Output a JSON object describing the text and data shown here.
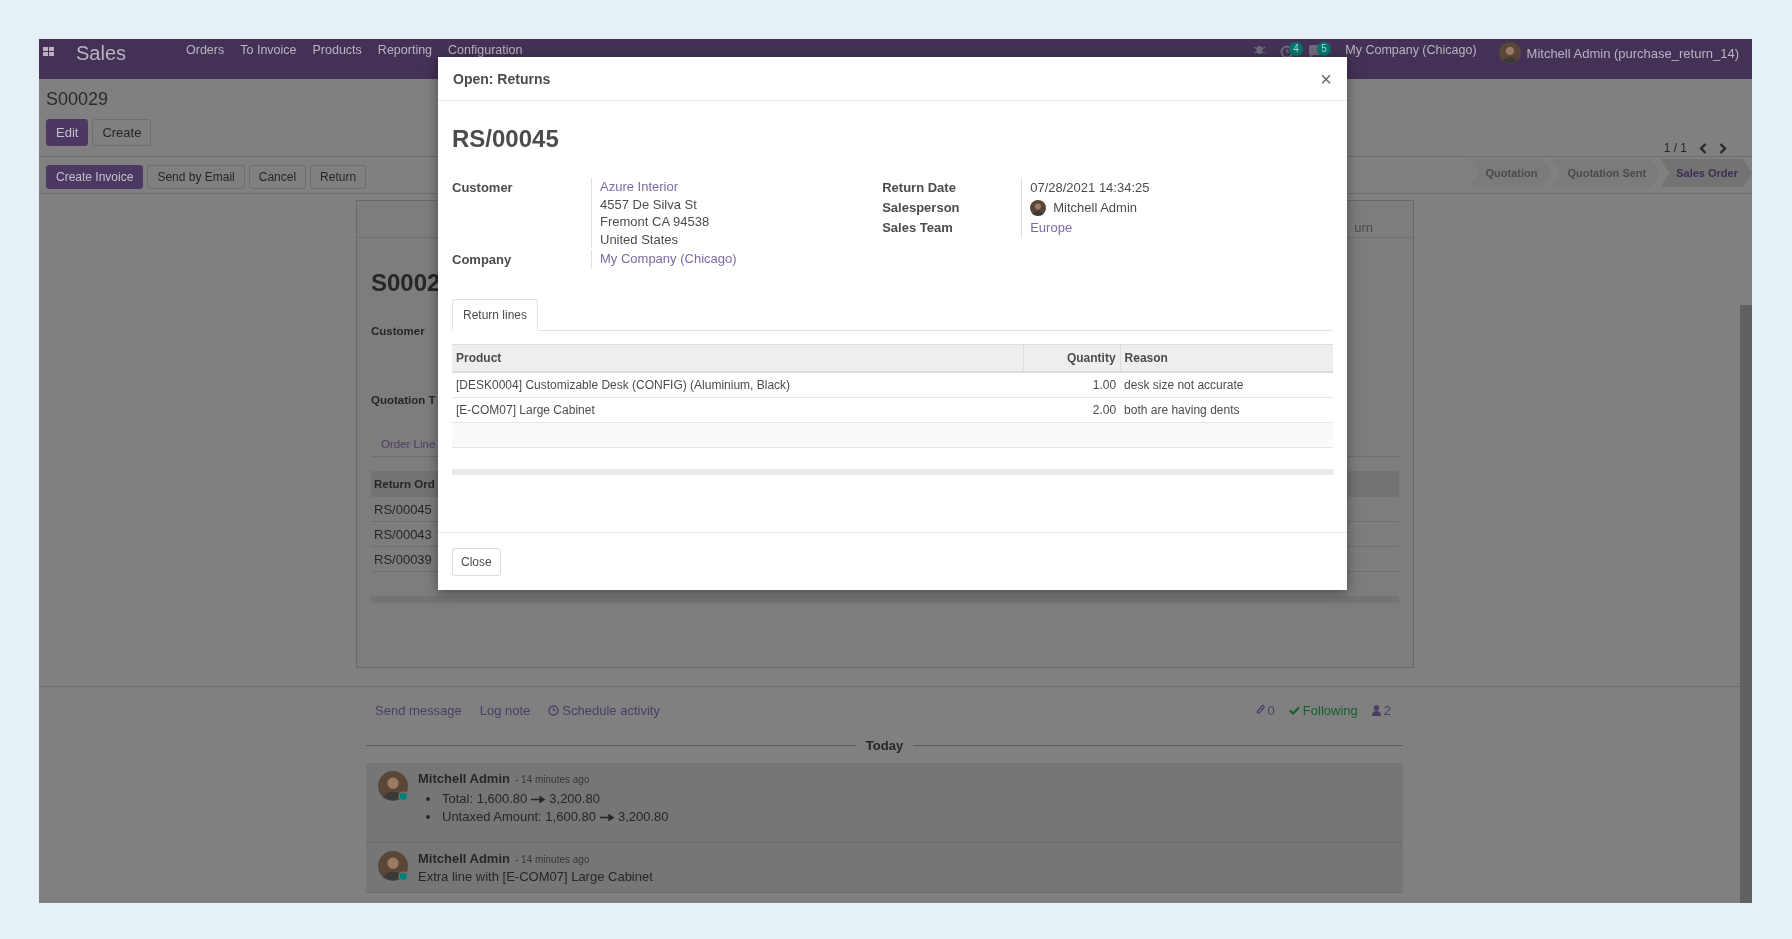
{
  "navbar": {
    "app": "Sales",
    "menu": [
      "Orders",
      "To Invoice",
      "Products",
      "Reporting",
      "Configuration"
    ],
    "activity_count": "4",
    "message_count": "5",
    "company": "My Company (Chicago)",
    "user": "Mitchell Admin (purchase_return_14)"
  },
  "control_panel": {
    "breadcrumb": "S00029",
    "buttons": [
      {
        "label": "Edit",
        "primary": true
      },
      {
        "label": "Create",
        "primary": false
      }
    ],
    "pager": "1 / 1",
    "actions": [
      {
        "label": "Create Invoice",
        "primary": true
      },
      {
        "label": "Send by Email",
        "primary": false
      },
      {
        "label": "Cancel",
        "primary": false
      },
      {
        "label": "Return",
        "primary": false
      }
    ],
    "statusbar": [
      {
        "label": "Quotation",
        "selected": false
      },
      {
        "label": "Quotation Sent",
        "selected": false
      },
      {
        "label": "Sales Order",
        "selected": true
      }
    ]
  },
  "form": {
    "title": "S0002",
    "peek_tab": "urn",
    "labels": [
      "Customer",
      "Quotation T"
    ],
    "tab": "Order Line",
    "table_header": "Return Ord",
    "rows": [
      "RS/00045",
      "RS/00043",
      "RS/00039"
    ]
  },
  "chatter": {
    "actions": [
      "Send message",
      "Log note",
      "Schedule activity"
    ],
    "attachments": "0",
    "following": "Following",
    "followers": "2",
    "separator": "Today",
    "messages": [
      {
        "author": "Mitchell Admin",
        "time": "- 14 minutes ago",
        "online": true,
        "changes": [
          {
            "old": "Total: 1,600.80",
            "new": "3,200.80"
          },
          {
            "old": "Untaxed Amount: 1,600.80",
            "new": "3,200.80"
          }
        ]
      },
      {
        "author": "Mitchell Admin",
        "time": "- 14 minutes ago",
        "online": true,
        "body": "Extra line with [E-COM07] Large Cabinet"
      }
    ]
  },
  "dialog": {
    "title": "Open: Returns",
    "close": "×",
    "name": "RS/00045",
    "left_fields": [
      {
        "label": "Customer",
        "values": [
          {
            "kind": "link",
            "text": "Azure Interior"
          },
          {
            "kind": "text",
            "text": "4557 De Silva St"
          },
          {
            "kind": "text",
            "text": "Fremont CA 94538"
          },
          {
            "kind": "text",
            "text": "United States"
          }
        ]
      },
      {
        "label": "Company",
        "values": [
          {
            "kind": "link",
            "text": "My Company (Chicago)"
          }
        ]
      }
    ],
    "right_fields": [
      {
        "label": "Return Date",
        "values": [
          {
            "kind": "text",
            "text": "07/28/2021 14:34:25"
          }
        ]
      },
      {
        "label": "Salesperson",
        "values": [
          {
            "kind": "user",
            "text": "Mitchell Admin"
          }
        ]
      },
      {
        "label": "Sales Team",
        "values": [
          {
            "kind": "link",
            "text": "Europe"
          }
        ]
      }
    ],
    "tabs": [
      {
        "label": "Return lines",
        "selected": true
      }
    ],
    "table": {
      "columns": [
        "Product",
        "Quantity",
        "Reason"
      ],
      "rows": [
        [
          "[DESK0004] Customizable Desk (CONFIG) (Aluminium, Black)",
          "1.00",
          "desk size not accurate"
        ],
        [
          "[E-COM07] Large Cabinet",
          "2.00",
          "both are having dents"
        ]
      ]
    },
    "footer_button": "Close"
  }
}
